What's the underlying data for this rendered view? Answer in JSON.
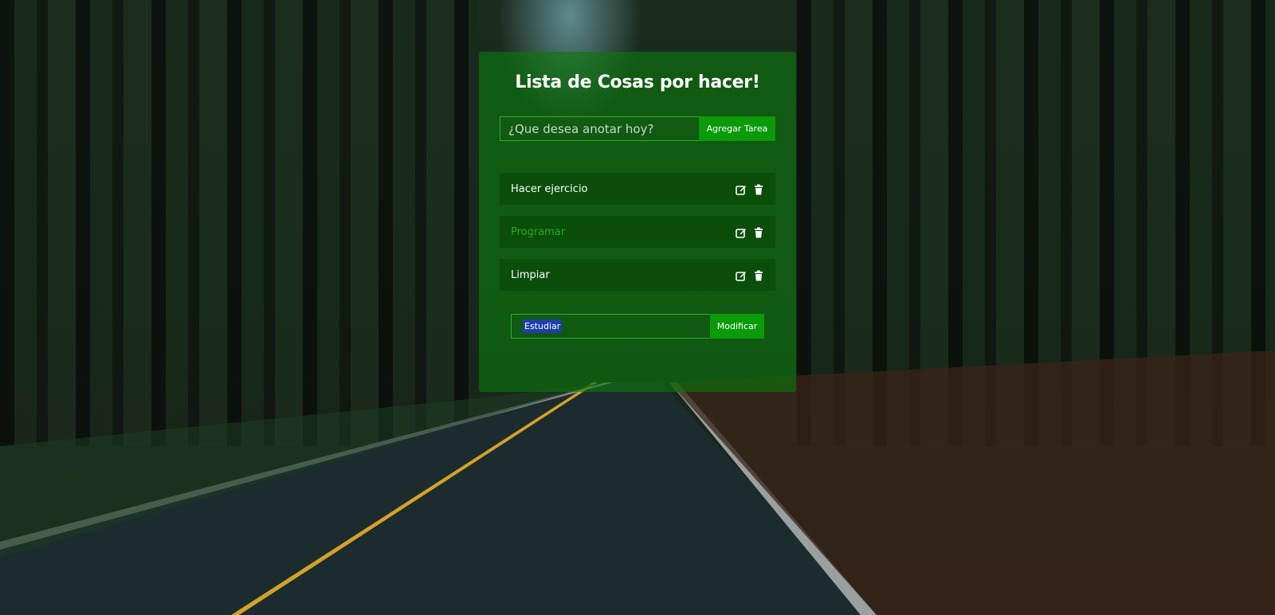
{
  "app": {
    "title": "Lista de Cosas por hacer!"
  },
  "add_task": {
    "placeholder": "¿Que desea anotar hoy?",
    "value": "",
    "button_label": "Agregar Tarea"
  },
  "tasks": [
    {
      "label": "Hacer ejercicio",
      "completed": false,
      "icons": [
        "edit-icon",
        "trash-icon"
      ]
    },
    {
      "label": "Programar",
      "completed": true,
      "icons": [
        "edit-icon",
        "trash-icon"
      ]
    },
    {
      "label": "Limpiar",
      "completed": false,
      "icons": [
        "edit-icon",
        "trash-icon"
      ]
    }
  ],
  "edit_task": {
    "value": "Estudiar",
    "selected": true,
    "button_label": "Modificar"
  },
  "colors": {
    "accent": "#0a9a0a",
    "panel": "#0c780c",
    "completed_text": "#1fae1f",
    "selection": "#1e3fa8"
  }
}
